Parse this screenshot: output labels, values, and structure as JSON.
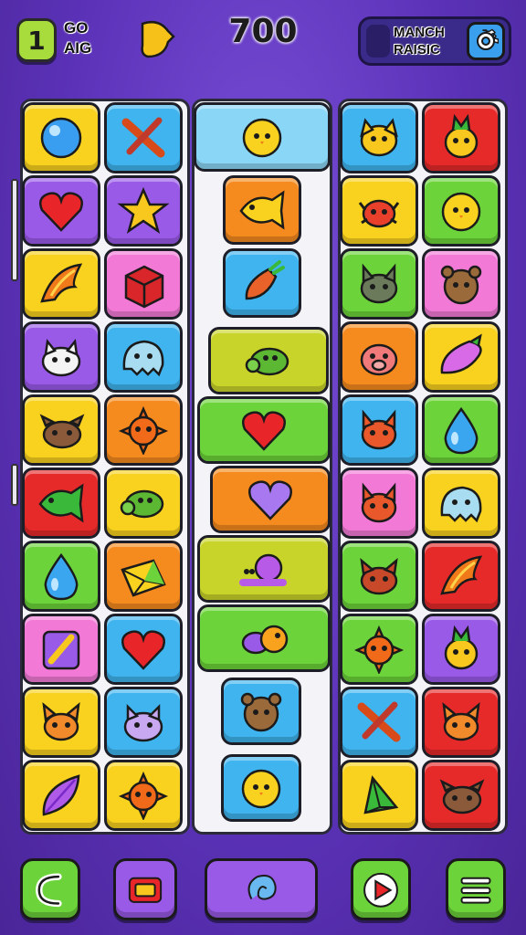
{
  "hud": {
    "level": "1",
    "go_label_line1": "GO",
    "go_label_line2": "AIG",
    "score": "700",
    "mode_line1": "MANCH",
    "mode_line2": "RAISIC"
  },
  "colors": {
    "yellow": "#f8d21e",
    "purple": "#9a5ae8",
    "pink": "#f27ad6",
    "blue": "#3fb4ee",
    "green": "#6cd43a",
    "red": "#e62a2a",
    "orange": "#f58a1e",
    "lime": "#c8d42a",
    "lightblue": "#8ad6f6"
  },
  "left_grid": [
    [
      {
        "bg": "yellow",
        "icon": "blue-orb-icon"
      },
      {
        "bg": "blue",
        "icon": "crossed-sticks-icon"
      }
    ],
    [
      {
        "bg": "purple",
        "icon": "heart-icon"
      },
      {
        "bg": "purple",
        "icon": "star-icon"
      }
    ],
    [
      {
        "bg": "yellow",
        "icon": "flame-leaf-icon"
      },
      {
        "bg": "pink",
        "icon": "red-cube-icon"
      }
    ],
    [
      {
        "bg": "purple",
        "icon": "white-cat-icon"
      },
      {
        "bg": "blue",
        "icon": "blue-blob-icon"
      }
    ],
    [
      {
        "bg": "yellow",
        "icon": "brown-dog-icon"
      },
      {
        "bg": "orange",
        "icon": "orange-sun-icon"
      }
    ],
    [
      {
        "bg": "red",
        "icon": "green-fish-icon"
      },
      {
        "bg": "yellow",
        "icon": "green-turtle-icon"
      }
    ],
    [
      {
        "bg": "green",
        "icon": "water-drop-icon"
      },
      {
        "bg": "orange",
        "icon": "gem-icon"
      }
    ],
    [
      {
        "bg": "pink",
        "icon": "rocket-card-icon"
      },
      {
        "bg": "blue",
        "icon": "heart-icon"
      }
    ],
    [
      {
        "bg": "yellow",
        "icon": "orange-fox-icon"
      },
      {
        "bg": "blue",
        "icon": "purple-cat-icon"
      }
    ],
    [
      {
        "bg": "yellow",
        "icon": "purple-leaf-icon"
      },
      {
        "bg": "yellow",
        "icon": "orange-sun-icon"
      }
    ]
  ],
  "center_column": [
    {
      "bg": "lightblue",
      "icon": "yellow-chick-icon"
    },
    {
      "bg": "orange",
      "icon": "yellow-fish-icon"
    },
    {
      "bg": "blue",
      "icon": "orange-carrot-icon"
    },
    {
      "bg": "lime",
      "icon": "green-turtle-icon"
    },
    {
      "bg": "green",
      "icon": "heart-icon"
    },
    {
      "bg": "orange",
      "icon": "purple-heart-icon"
    },
    {
      "bg": "lime",
      "icon": "purple-snail-icon"
    },
    {
      "bg": "green",
      "icon": "bird-pair-icon"
    },
    {
      "bg": "blue",
      "icon": "brown-bear-icon"
    },
    {
      "bg": "blue",
      "icon": "yellow-chick-icon"
    }
  ],
  "right_grid": [
    [
      {
        "bg": "blue",
        "icon": "yellow-dog-icon"
      },
      {
        "bg": "red",
        "icon": "yellow-pineapple-icon"
      }
    ],
    [
      {
        "bg": "yellow",
        "icon": "red-crab-icon"
      },
      {
        "bg": "green",
        "icon": "yellow-chick-icon"
      }
    ],
    [
      {
        "bg": "green",
        "icon": "gray-cat-icon"
      },
      {
        "bg": "pink",
        "icon": "brown-bear-icon"
      }
    ],
    [
      {
        "bg": "orange",
        "icon": "pink-pig-icon"
      },
      {
        "bg": "yellow",
        "icon": "purple-eggplant-icon"
      }
    ],
    [
      {
        "bg": "blue",
        "icon": "orange-cat-icon"
      },
      {
        "bg": "green",
        "icon": "water-drop-icon"
      }
    ],
    [
      {
        "bg": "pink",
        "icon": "orange-cat-icon"
      },
      {
        "bg": "yellow",
        "icon": "blue-blob-icon"
      }
    ],
    [
      {
        "bg": "green",
        "icon": "red-fox-icon"
      },
      {
        "bg": "red",
        "icon": "flame-leaf-icon"
      }
    ],
    [
      {
        "bg": "green",
        "icon": "orange-sun-icon"
      },
      {
        "bg": "purple",
        "icon": "yellow-pineapple-icon"
      }
    ],
    [
      {
        "bg": "blue",
        "icon": "crossed-sticks-icon"
      },
      {
        "bg": "red",
        "icon": "orange-fox-icon"
      }
    ],
    [
      {
        "bg": "yellow",
        "icon": "green-gem-icon"
      },
      {
        "bg": "red",
        "icon": "brown-dog-icon"
      }
    ]
  ],
  "bottom_bar": [
    {
      "name": "back-button",
      "icon": "back-arrow-icon",
      "bg": "green"
    },
    {
      "name": "shop-button",
      "icon": "shop-box-icon",
      "bg": "purple"
    },
    {
      "name": "hint-button",
      "icon": "swirl-icon",
      "bg": "purple"
    },
    {
      "name": "play-button",
      "icon": "play-icon",
      "bg": "green"
    },
    {
      "name": "menu-button",
      "icon": "menu-icon",
      "bg": "green"
    }
  ]
}
